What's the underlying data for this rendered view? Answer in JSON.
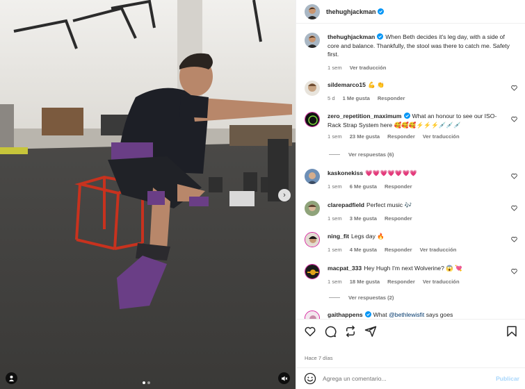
{
  "post": {
    "username": "thehughjackman",
    "caption_user": "thehughjackman",
    "caption": "When Beth decides it's leg day, with a side of core and balance. Thankfully, the stool was there to catch me. Safety first.",
    "caption_time": "1 sem",
    "caption_translate": "Ver traducción",
    "carousel": {
      "total": 2,
      "current": 1
    }
  },
  "comments": [
    {
      "user": "sildemarco15",
      "text": "💪 👏",
      "time": "5 d",
      "likes": "1 Me gusta",
      "reply": "Responder",
      "translate": "",
      "verified": false
    },
    {
      "user": "zero_repetition_maximum",
      "text": "What an honour to see our ISO-Rack Strap System here 🥰🥰🥰⚡⚡⚡💉💉💉",
      "time": "1 sem",
      "likes": "23 Me gusta",
      "reply": "Responder",
      "translate": "Ver traducción",
      "verified": true,
      "view_replies": "Ver respuestas (6)"
    },
    {
      "user": "kaskonekiss",
      "text": "💗💗💗💗💗💗💗",
      "time": "1 sem",
      "likes": "6 Me gusta",
      "reply": "Responder",
      "translate": "",
      "verified": false
    },
    {
      "user": "clarepadfield",
      "text": "Perfect music 🎶",
      "time": "1 sem",
      "likes": "3 Me gusta",
      "reply": "Responder",
      "translate": "",
      "verified": false
    },
    {
      "user": "ning_fit",
      "text": "Legs day 🔥",
      "time": "1 sem",
      "likes": "4 Me gusta",
      "reply": "Responder",
      "translate": "Ver traducción",
      "verified": false
    },
    {
      "user": "macpat_333",
      "text": "Hey Hugh I'm next Wolverine? 😱 💘",
      "time": "1 sem",
      "likes": "18 Me gusta",
      "reply": "Responder",
      "translate": "Ver traducción",
      "verified": false,
      "view_replies": "Ver respuestas (2)"
    },
    {
      "user": "gaithappens",
      "text": "What ",
      "mention": "@bethlewisfit",
      "text_after": " says goes",
      "verified": true
    }
  ],
  "footer": {
    "time_ago": "Hace 7 días",
    "comment_placeholder": "Agrega un comentario...",
    "post_label": "Publicar"
  },
  "colors": {
    "link": "#00376b",
    "meta": "#737373",
    "verified": "#0095f6",
    "post_button": "#a8d6fb"
  },
  "icons": {
    "like": "heart-icon",
    "comment": "comment-icon",
    "share": "share-icon",
    "repost": "repost-icon",
    "save": "bookmark-icon"
  }
}
